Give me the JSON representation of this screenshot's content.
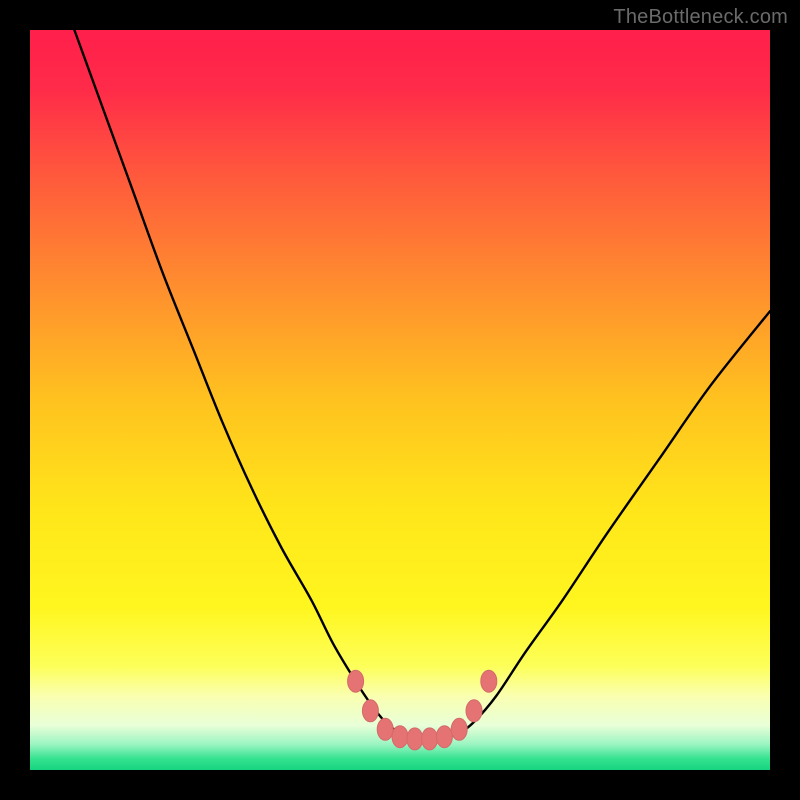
{
  "watermark": "TheBottleneck.com",
  "colors": {
    "frame": "#000000",
    "curve": "#000000",
    "marker_fill": "#e57373",
    "marker_stroke": "#d46a6a",
    "gradient_stops": [
      {
        "offset": 0.0,
        "color": "#ff1f4b"
      },
      {
        "offset": 0.08,
        "color": "#ff2b49"
      },
      {
        "offset": 0.2,
        "color": "#ff5a3c"
      },
      {
        "offset": 0.35,
        "color": "#ff8f2e"
      },
      {
        "offset": 0.5,
        "color": "#ffc21f"
      },
      {
        "offset": 0.65,
        "color": "#ffe61a"
      },
      {
        "offset": 0.78,
        "color": "#fff61f"
      },
      {
        "offset": 0.86,
        "color": "#fdff5a"
      },
      {
        "offset": 0.9,
        "color": "#faffb0"
      },
      {
        "offset": 0.94,
        "color": "#e8ffd8"
      },
      {
        "offset": 0.965,
        "color": "#9cf5c2"
      },
      {
        "offset": 0.985,
        "color": "#34e28f"
      },
      {
        "offset": 1.0,
        "color": "#16d47f"
      }
    ]
  },
  "chart_data": {
    "type": "line",
    "title": "",
    "xlabel": "",
    "ylabel": "",
    "xlim": [
      0,
      100
    ],
    "ylim": [
      0,
      100
    ],
    "grid": false,
    "legend": false,
    "series": [
      {
        "name": "bottleneck-curve",
        "x": [
          6,
          10,
          14,
          18,
          22,
          26,
          30,
          34,
          38,
          41,
          44,
          46,
          48,
          50,
          52,
          54,
          56,
          58,
          60,
          63,
          67,
          72,
          78,
          85,
          92,
          100
        ],
        "y": [
          100,
          89,
          78,
          67,
          57,
          47,
          38,
          30,
          23,
          17,
          12,
          9,
          6.5,
          5,
          4.3,
          4,
          4.3,
          5,
          6.5,
          10,
          16,
          23,
          32,
          42,
          52,
          62
        ]
      }
    ],
    "markers": {
      "name": "highlight-points",
      "x": [
        44,
        46,
        48,
        50,
        52,
        54,
        56,
        58,
        60,
        62
      ],
      "y": [
        12,
        8,
        5.5,
        4.5,
        4.2,
        4.2,
        4.5,
        5.5,
        8,
        12
      ]
    }
  }
}
